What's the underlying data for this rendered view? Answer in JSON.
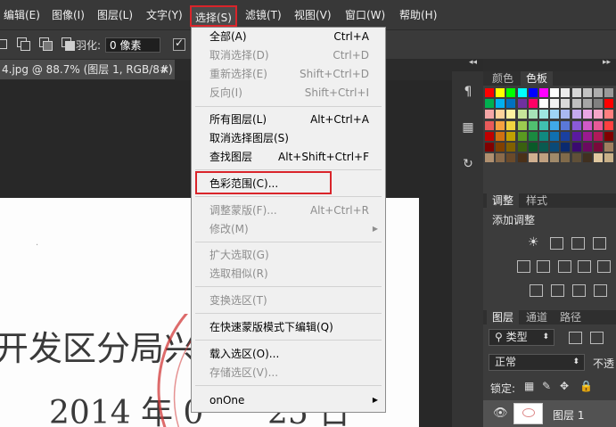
{
  "menubar": {
    "items": [
      "编辑(E)",
      "图像(I)",
      "图层(L)",
      "文字(Y)",
      "选择(S)",
      "滤镜(T)",
      "视图(V)",
      "窗口(W)",
      "帮助(H)"
    ],
    "active_index": 4
  },
  "options": {
    "feather_label": "羽化:",
    "feather_value": "0 像素"
  },
  "document_tab": {
    "title": "4.jpg @ 88.7% (图层 1, RGB/8#) *",
    "close": "×"
  },
  "select_menu": {
    "items": [
      {
        "label": "全部(A)",
        "shortcut": "Ctrl+A",
        "disabled": false
      },
      {
        "label": "取消选择(D)",
        "shortcut": "Ctrl+D",
        "disabled": true
      },
      {
        "label": "重新选择(E)",
        "shortcut": "Shift+Ctrl+D",
        "disabled": true
      },
      {
        "label": "反向(I)",
        "shortcut": "Shift+Ctrl+I",
        "disabled": true
      },
      {
        "label": "所有图层(L)",
        "shortcut": "Alt+Ctrl+A",
        "disabled": false
      },
      {
        "label": "取消选择图层(S)",
        "shortcut": "",
        "disabled": false
      },
      {
        "label": "查找图层",
        "shortcut": "Alt+Shift+Ctrl+F",
        "disabled": false
      },
      {
        "label": "色彩范围(C)...",
        "shortcut": "",
        "disabled": false,
        "highlighted": true
      },
      {
        "label": "调整蒙版(F)...",
        "shortcut": "Alt+Ctrl+R",
        "disabled": true
      },
      {
        "label": "修改(M)",
        "shortcut": "",
        "disabled": true,
        "submenu": true
      },
      {
        "label": "扩大选取(G)",
        "shortcut": "",
        "disabled": true
      },
      {
        "label": "选取相似(R)",
        "shortcut": "",
        "disabled": true
      },
      {
        "label": "变换选区(T)",
        "shortcut": "",
        "disabled": true
      },
      {
        "label": "在快速蒙版模式下编辑(Q)",
        "shortcut": "",
        "disabled": false
      },
      {
        "label": "载入选区(O)...",
        "shortcut": "",
        "disabled": false
      },
      {
        "label": "存储选区(V)...",
        "shortcut": "",
        "disabled": true
      },
      {
        "label": "onOne",
        "shortcut": "",
        "disabled": false,
        "submenu": true
      }
    ]
  },
  "document_content": {
    "line1": "开发区分局兴",
    "line2": "2014 年 0",
    "line2_tail": "25 日"
  },
  "swatches_panel": {
    "tabs": [
      "颜色",
      "色板"
    ],
    "active_tab": 1
  },
  "adjustments_panel": {
    "tabs": [
      "调整",
      "样式"
    ],
    "title": "添加调整"
  },
  "layers_panel": {
    "tabs": [
      "图层",
      "通道",
      "路径"
    ],
    "filter_kind": "类型",
    "blend_mode": "正常",
    "opacity_label": "不透",
    "lock_label": "锁定:",
    "layer_name": "图层 1"
  },
  "colors": {
    "highlight_red": "#d9242a",
    "menu_bg": "#f0f0f0",
    "ui_dark": "#383838"
  }
}
